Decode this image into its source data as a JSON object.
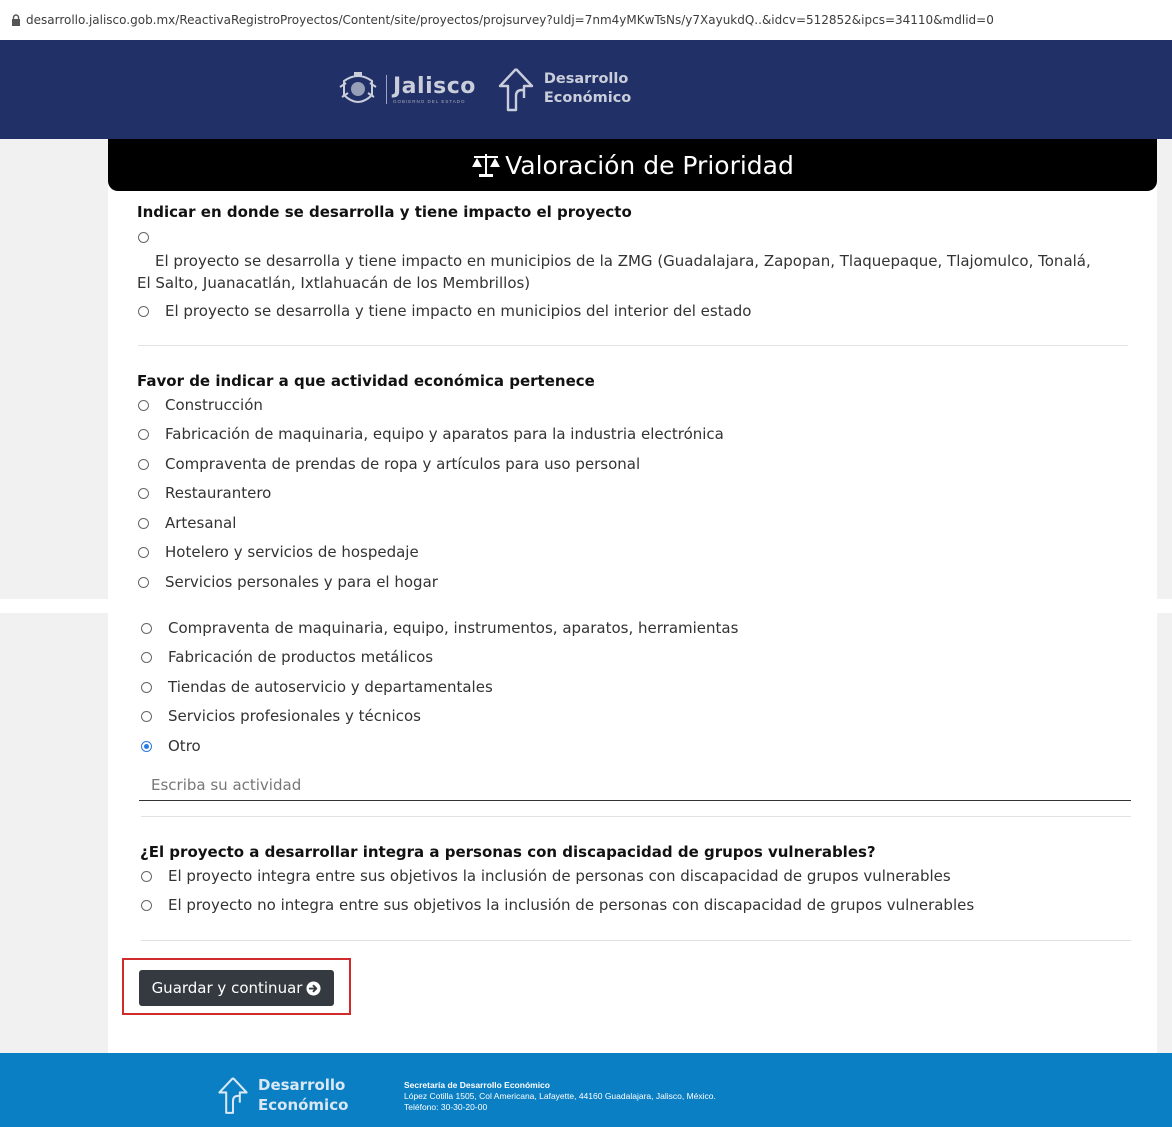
{
  "browser": {
    "url": "desarrollo.jalisco.gob.mx/ReactivaRegistroProyectos/Content/site/proyectos/projsurvey?uldj=7nm4yMKwTsNs/y7XayukdQ..&idcv=512852&ipcs=34110&mdlid=0"
  },
  "header": {
    "jalisco_word": "Jalisco",
    "jalisco_sub": "GOBIERNO DEL ESTADO",
    "de_line1": "Desarrollo",
    "de_line2": "Económico"
  },
  "title": "Valoración de Prioridad",
  "q1": {
    "label": "Indicar en donde se desarrolla y tiene impacto el proyecto",
    "options": [
      "El proyecto se desarrolla y tiene impacto en municipios de la ZMG (Guadalajara, Zapopan, Tlaquepaque, Tlajomulco, Tonalá, El Salto, Juanacatlán, Ixtlahuacán de los Membrillos)",
      "El proyecto se desarrolla y tiene impacto en municipios del interior del estado"
    ]
  },
  "q2": {
    "label": "Favor de indicar a que actividad económica pertenece",
    "options": [
      "Construcción",
      "Fabricación de maquinaria, equipo y aparatos para la industria electrónica",
      "Compraventa de prendas de ropa y artículos para uso personal",
      "Restaurantero",
      "Artesanal",
      "Hotelero y servicios de hospedaje",
      "Servicios personales y para el hogar",
      "Compraventa de maquinaria, equipo, instrumentos, aparatos, herramientas",
      "Fabricación de productos metálicos",
      "Tiendas de autoservicio y departamentales",
      "Servicios profesionales y técnicos",
      "Otro"
    ],
    "selected": "Otro",
    "other_placeholder": "Escriba su actividad"
  },
  "q3": {
    "label": "¿El proyecto a desarrollar integra a personas con discapacidad de grupos vulnerables?",
    "options": [
      "El proyecto integra entre sus objetivos la inclusión de personas con discapacidad de grupos vulnerables",
      "El proyecto no integra entre sus objetivos la inclusión de personas con discapacidad de grupos vulnerables"
    ]
  },
  "submit_label": "Guardar y continuar",
  "footer": {
    "de_line1": "Desarrollo",
    "de_line2": "Económico",
    "org": "Secretaría de Desarrollo Económico",
    "address": "López Cotilla 1505, Col Americana, Lafayette, 44160 Guadalajara, Jalisco, México.",
    "phone": "Teléfono: 30-30-20-00"
  },
  "colors": {
    "header": "#223068",
    "footer": "#0a7fc4",
    "button": "#343a40",
    "highlight": "#d02a2a",
    "radio_checked": "#2a7ae2"
  }
}
